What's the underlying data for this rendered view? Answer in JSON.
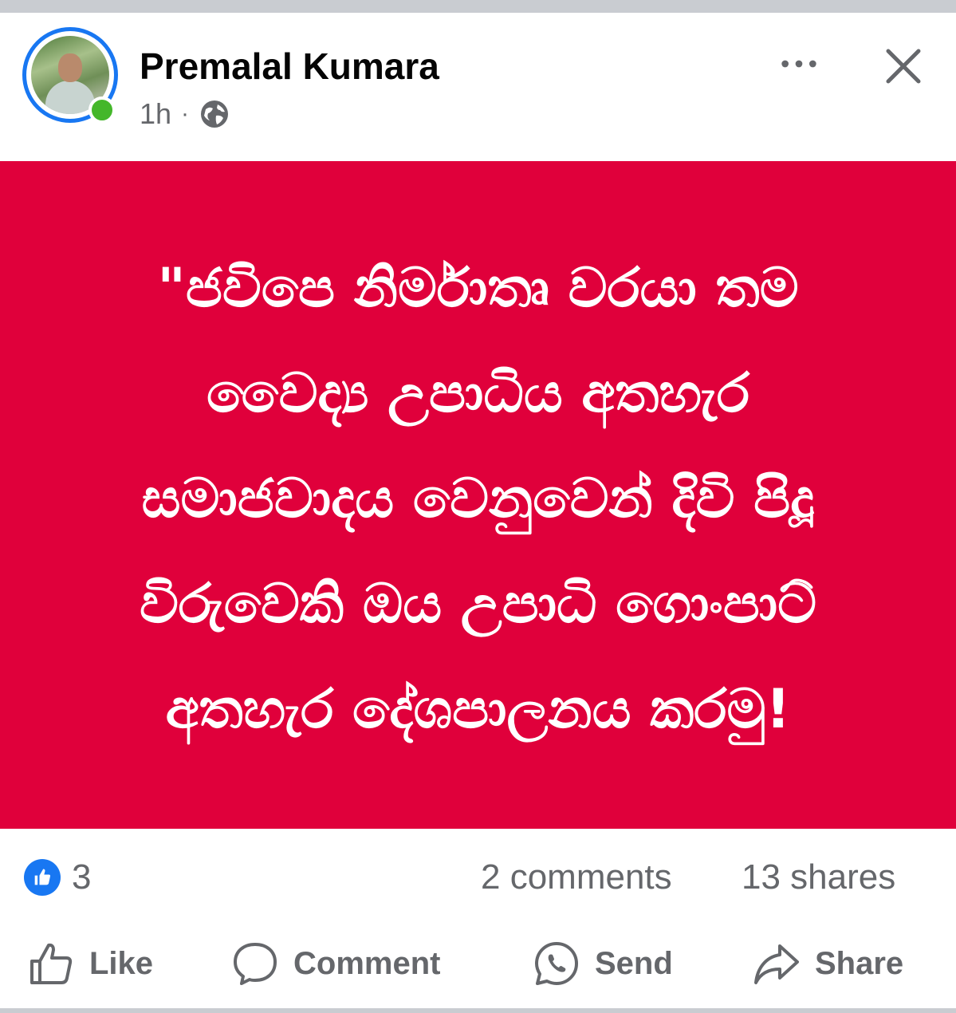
{
  "author": {
    "name": "Premalal Kumara",
    "time": "1h",
    "separator": "·",
    "audience_icon": "globe-icon",
    "online": true
  },
  "header_actions": {
    "more_icon": "more-horizontal-icon",
    "close_icon": "close-icon"
  },
  "post": {
    "background_color": "#e0003b",
    "text_color": "#ffffff",
    "lines": [
      "\"ජවිපෙ නිර්මාතෘ වරයා තම",
      "වෛද්‍ය උපාධිය අතහැර",
      "සමාජවාදය වෙනුවෙන් දිවි පිදූ",
      "විරුවෙකි ඔය උපාධි ගොංපාට්",
      "අතහැර දේශපාලනය කරමු!"
    ]
  },
  "stats": {
    "reactions_icon": "like-reaction-icon",
    "reactions_count": "3",
    "comments": "2 comments",
    "shares": "13 shares"
  },
  "actions": [
    {
      "label": "Like",
      "icon": "thumbs-up-icon"
    },
    {
      "label": "Comment",
      "icon": "comment-icon"
    },
    {
      "label": "Send",
      "icon": "whatsapp-icon"
    },
    {
      "label": "Share",
      "icon": "share-icon"
    }
  ],
  "colors": {
    "accent": "#1877f2",
    "online": "#44b72a",
    "secondary_text": "#65676b"
  }
}
